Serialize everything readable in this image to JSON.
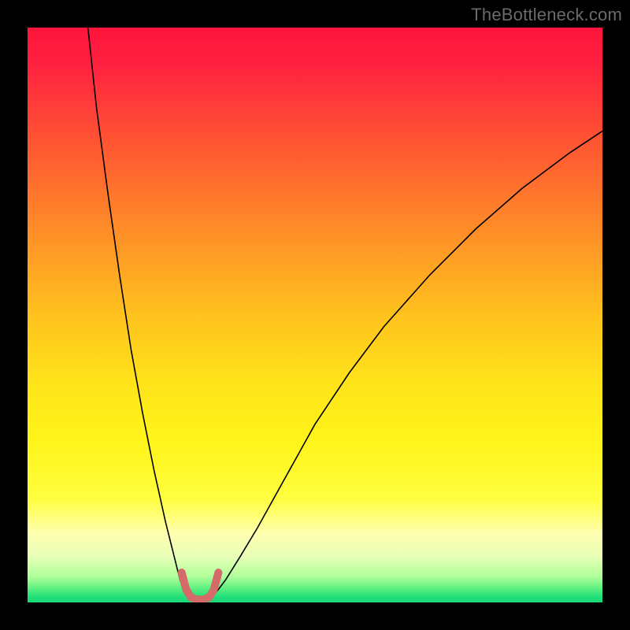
{
  "watermark": "TheBottleneck.com",
  "chart_data": {
    "type": "line",
    "title": "",
    "xlabel": "",
    "ylabel": "",
    "xlim": [
      0,
      100
    ],
    "ylim": [
      0,
      100
    ],
    "background_gradient": {
      "stops": [
        {
          "offset": 0.0,
          "color": "#ff143c"
        },
        {
          "offset": 0.06,
          "color": "#ff2040"
        },
        {
          "offset": 0.2,
          "color": "#ff5532"
        },
        {
          "offset": 0.35,
          "color": "#ff8c28"
        },
        {
          "offset": 0.5,
          "color": "#ffc21e"
        },
        {
          "offset": 0.62,
          "color": "#ffe41a"
        },
        {
          "offset": 0.72,
          "color": "#fff41a"
        },
        {
          "offset": 0.82,
          "color": "#ffff40"
        },
        {
          "offset": 0.88,
          "color": "#ffffb0"
        },
        {
          "offset": 0.92,
          "color": "#e8ffb8"
        },
        {
          "offset": 0.955,
          "color": "#b0ff9a"
        },
        {
          "offset": 0.975,
          "color": "#60f080"
        },
        {
          "offset": 0.99,
          "color": "#22e07a"
        },
        {
          "offset": 1.0,
          "color": "#18d878"
        }
      ]
    },
    "series": [
      {
        "name": "curve-left",
        "color": "#000000",
        "width": 1.6,
        "x": [
          10.5,
          12,
          14,
          16,
          18,
          20,
          22,
          24,
          25.5,
          26.5,
          27.2,
          27.8
        ],
        "y": [
          100,
          86,
          71,
          57,
          44,
          33,
          23,
          14,
          8,
          4,
          2,
          1.2
        ]
      },
      {
        "name": "curve-right",
        "color": "#000000",
        "width": 1.6,
        "x": [
          32.2,
          33,
          34.5,
          37,
          40,
          45,
          50,
          56,
          62,
          70,
          78,
          86,
          94,
          100
        ],
        "y": [
          1.2,
          2,
          4,
          8,
          13,
          22,
          31,
          40,
          48,
          57,
          65,
          72,
          78,
          82
        ]
      },
      {
        "name": "valley-highlight",
        "color": "#d46a6a",
        "width": 10,
        "linecap": "round",
        "x": [
          26.8,
          27.6,
          28.4,
          29.4,
          30.6,
          31.6,
          32.4,
          33.2
        ],
        "y": [
          5.2,
          2.2,
          0.9,
          0.5,
          0.5,
          0.9,
          2.2,
          5.2
        ]
      }
    ]
  }
}
